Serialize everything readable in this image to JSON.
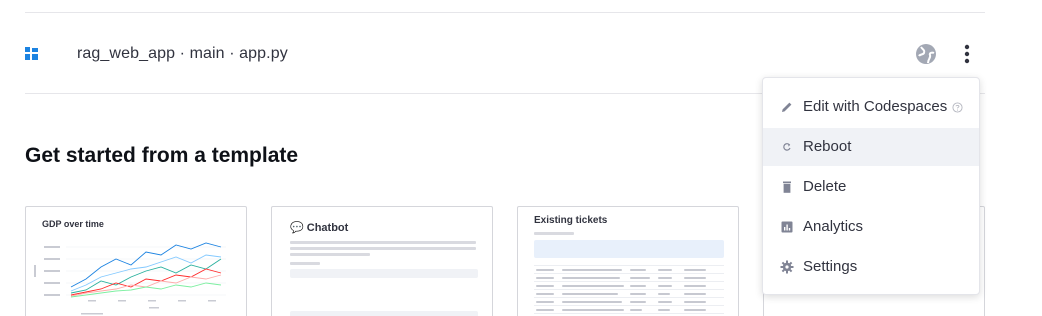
{
  "app": {
    "name": "rag_web_app · main · app.py",
    "icon": "streamlit-app-icon",
    "globe_icon": "globe-icon",
    "more_icon": "more-vertical-icon"
  },
  "templates": {
    "heading": "Get started from a template",
    "cards": [
      {
        "title": "GDP over time"
      },
      {
        "title": "💬 Chatbot"
      },
      {
        "title": "Existing tickets"
      },
      {
        "title": ""
      }
    ]
  },
  "menu": {
    "items": [
      {
        "label": "Edit with Codespaces",
        "icon": "pencil-icon",
        "help_icon": "help-circle-icon"
      },
      {
        "label": "Reboot",
        "icon": "refresh-icon"
      },
      {
        "label": "Delete",
        "icon": "trash-icon"
      },
      {
        "label": "Analytics",
        "icon": "analytics-icon"
      },
      {
        "label": "Settings",
        "icon": "gear-icon"
      }
    ]
  },
  "colors": {
    "accent_blue": "#1c83e1",
    "text": "#31333f",
    "icon_gray": "#808495",
    "hover_bg": "#f0f2f6"
  }
}
